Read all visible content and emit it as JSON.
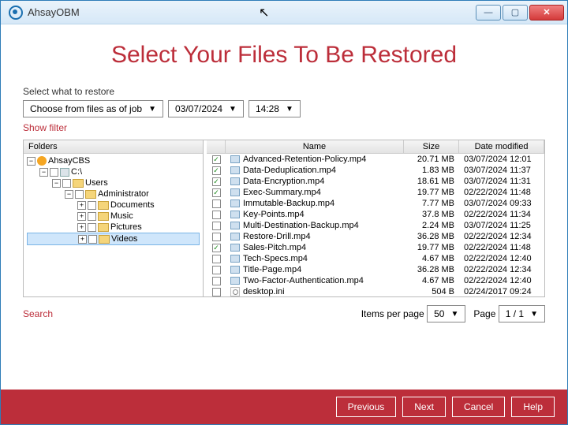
{
  "app": {
    "title": "AhsayOBM"
  },
  "winbtns": {
    "min": "—",
    "max": "▢",
    "close": "✕"
  },
  "heading": "Select Your Files To Be Restored",
  "restoreLabel": "Select what to restore",
  "mode": "Choose from files as of job",
  "date": "03/07/2024",
  "time": "14:28",
  "showFilter": "Show filter",
  "tree": {
    "header": "Folders",
    "root": "AhsayCBS",
    "drive": "C:\\",
    "users": "Users",
    "admin": "Administrator",
    "docs": "Documents",
    "music": "Music",
    "pics": "Pictures",
    "videos": "Videos"
  },
  "list": {
    "headers": {
      "name": "Name",
      "size": "Size",
      "date": "Date modified"
    },
    "rows": [
      {
        "chk": true,
        "icon": "video",
        "name": "Advanced-Retention-Policy.mp4",
        "size": "20.71 MB",
        "date": "03/07/2024 12:01"
      },
      {
        "chk": true,
        "icon": "video",
        "name": "Data-Deduplication.mp4",
        "size": "1.83 MB",
        "date": "03/07/2024 11:37"
      },
      {
        "chk": true,
        "icon": "video",
        "name": "Data-Encryption.mp4",
        "size": "18.61 MB",
        "date": "03/07/2024 11:31"
      },
      {
        "chk": true,
        "icon": "video",
        "name": "Exec-Summary.mp4",
        "size": "19.77 MB",
        "date": "02/22/2024 11:48"
      },
      {
        "chk": false,
        "icon": "video",
        "name": "Immutable-Backup.mp4",
        "size": "7.77 MB",
        "date": "03/07/2024 09:33"
      },
      {
        "chk": false,
        "icon": "video",
        "name": "Key-Points.mp4",
        "size": "37.8 MB",
        "date": "02/22/2024 11:34"
      },
      {
        "chk": false,
        "icon": "video",
        "name": "Multi-Destination-Backup.mp4",
        "size": "2.24 MB",
        "date": "03/07/2024 11:25"
      },
      {
        "chk": false,
        "icon": "video",
        "name": "Restore-Drill.mp4",
        "size": "36.28 MB",
        "date": "02/22/2024 12:34"
      },
      {
        "chk": true,
        "icon": "video",
        "name": "Sales-Pitch.mp4",
        "size": "19.77 MB",
        "date": "02/22/2024 11:48"
      },
      {
        "chk": false,
        "icon": "video",
        "name": "Tech-Specs.mp4",
        "size": "4.67 MB",
        "date": "02/22/2024 12:40"
      },
      {
        "chk": false,
        "icon": "video",
        "name": "Title-Page.mp4",
        "size": "36.28 MB",
        "date": "02/22/2024 12:34"
      },
      {
        "chk": false,
        "icon": "video",
        "name": "Two-Factor-Authentication.mp4",
        "size": "4.67 MB",
        "date": "02/22/2024 12:40"
      },
      {
        "chk": false,
        "icon": "ini",
        "name": "desktop.ini",
        "size": "504 B",
        "date": "02/24/2017 09:24"
      }
    ]
  },
  "paging": {
    "ippLabel": "Items per page",
    "ipp": "50",
    "pageLabel": "Page",
    "page": "1 / 1"
  },
  "searchLabel": "Search",
  "footer": {
    "prev": "Previous",
    "next": "Next",
    "cancel": "Cancel",
    "help": "Help"
  }
}
